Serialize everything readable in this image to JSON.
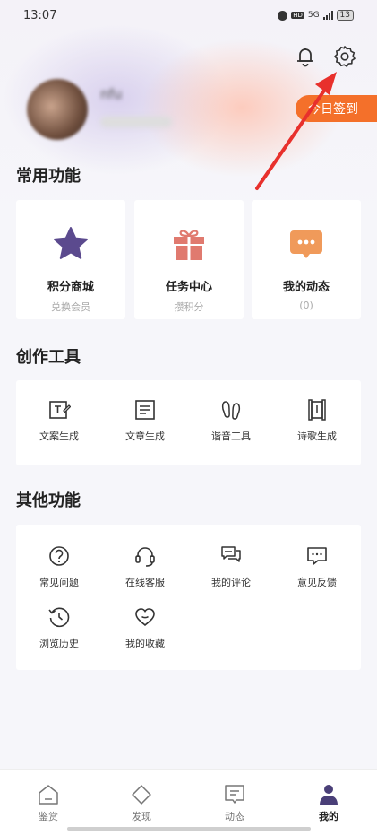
{
  "status_bar": {
    "time": "13:07",
    "hd": "HD",
    "network": "5G",
    "battery": "13"
  },
  "profile": {
    "username": "nfu",
    "checkin_label": "今日签到"
  },
  "sections": {
    "common": "常用功能",
    "tools": "创作工具",
    "other": "其他功能"
  },
  "common_functions": [
    {
      "title": "积分商城",
      "subtitle": "兑换会员",
      "icon": "star-icon"
    },
    {
      "title": "任务中心",
      "subtitle": "攒积分",
      "icon": "gift-icon"
    },
    {
      "title": "我的动态",
      "subtitle": "(0)",
      "icon": "chat-bubble-icon"
    }
  ],
  "creation_tools": [
    {
      "label": "文案生成",
      "icon": "copywriting-icon"
    },
    {
      "label": "文章生成",
      "icon": "article-icon"
    },
    {
      "label": "谐音工具",
      "icon": "homophone-icon"
    },
    {
      "label": "诗歌生成",
      "icon": "scroll-icon"
    }
  ],
  "other_functions": [
    {
      "label": "常见问题",
      "icon": "question-icon"
    },
    {
      "label": "在线客服",
      "icon": "headset-icon"
    },
    {
      "label": "我的评论",
      "icon": "comments-icon"
    },
    {
      "label": "意见反馈",
      "icon": "feedback-icon"
    },
    {
      "label": "浏览历史",
      "icon": "history-icon"
    },
    {
      "label": "我的收藏",
      "icon": "heart-icon"
    }
  ],
  "tabbar": [
    {
      "label": "鉴赏",
      "icon": "appreciate-icon"
    },
    {
      "label": "发现",
      "icon": "discover-icon"
    },
    {
      "label": "动态",
      "icon": "feed-icon"
    },
    {
      "label": "我的",
      "icon": "profile-icon",
      "active": true
    }
  ],
  "colors": {
    "accent": "#f4702a",
    "star": "#5b4a8e",
    "gift": "#e07a6f",
    "bubble": "#f09a5a",
    "arrow": "#e8302c"
  }
}
